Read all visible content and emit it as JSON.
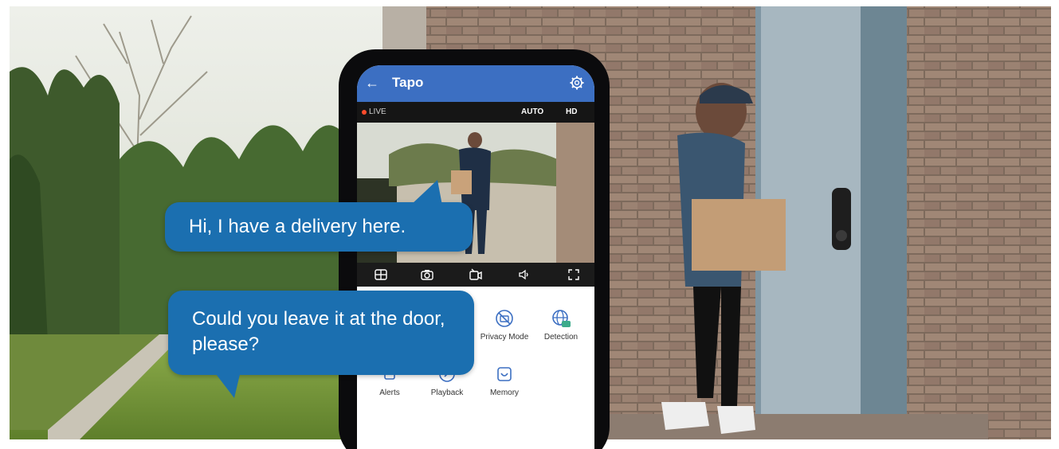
{
  "app": {
    "title": "Tapo",
    "back_icon": "arrow-left-icon",
    "settings_icon": "gear-icon",
    "accent_color": "#3c6fc2"
  },
  "live_bar": {
    "live": "LIVE",
    "auto": "AUTO",
    "hd": "HD",
    "live_color": "#ff4b2b"
  },
  "toolbar": {
    "icons": [
      "grid-icon",
      "camera-icon",
      "record-icon",
      "speaker-icon",
      "fullscreen-icon"
    ]
  },
  "features": [
    {
      "label": "Privacy Mode",
      "icon": "privacy-icon"
    },
    {
      "label": "Detection",
      "icon": "detection-icon"
    },
    {
      "label": "Alerts",
      "icon": "alert-icon"
    },
    {
      "label": "Playback",
      "icon": "playback-icon"
    },
    {
      "label": "Memory",
      "icon": "memory-icon"
    }
  ],
  "bubbles": {
    "visitor": "Hi, I have a delivery here.",
    "owner": "Could you leave it at the door, please?",
    "color": "#1b6fb0"
  }
}
